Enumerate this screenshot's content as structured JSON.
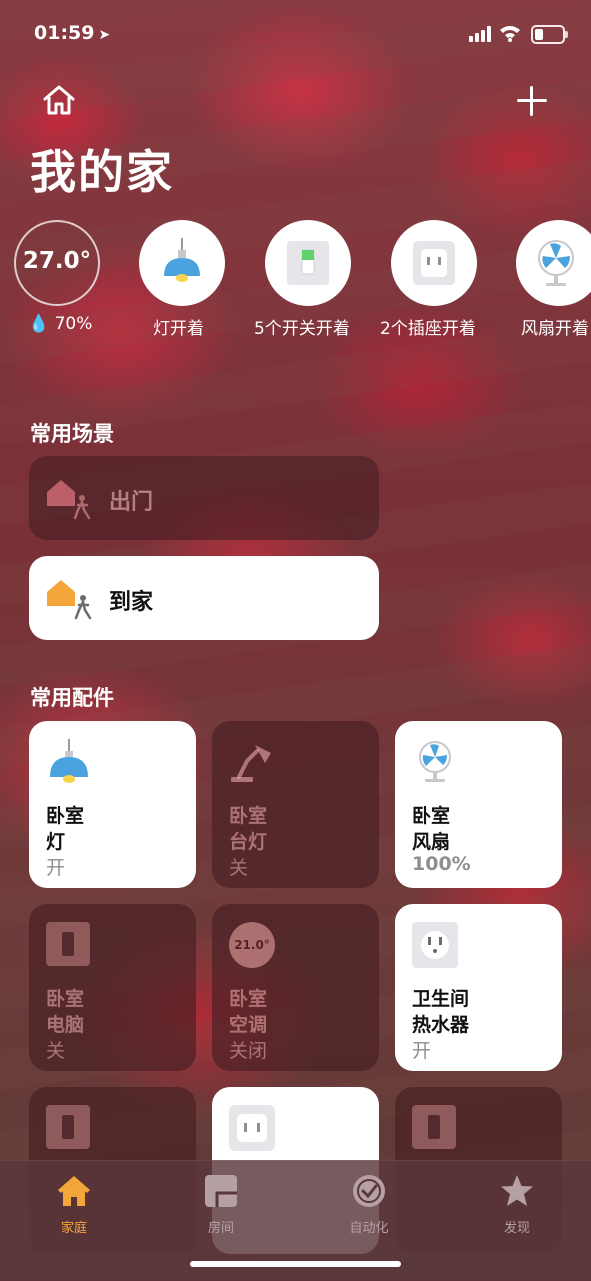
{
  "status_bar": {
    "time": "01:59",
    "location_glyph": "➤"
  },
  "header": {
    "title": "我的家"
  },
  "status_items": [
    {
      "label": "70%",
      "value": "27.0°",
      "icon": "humidity-drop-icon"
    },
    {
      "label": "灯开着",
      "icon": "pendant-lamp-icon"
    },
    {
      "label": "5个开关开着",
      "icon": "switch-icon"
    },
    {
      "label": "2个插座开着",
      "icon": "outlet-icon"
    },
    {
      "label": "风扇开着",
      "icon": "fan-icon"
    }
  ],
  "sections": {
    "scenes": "常用场景",
    "accessories": "常用配件"
  },
  "scenes": [
    {
      "label": "出门",
      "state": "off"
    },
    {
      "label": "到家",
      "state": "on"
    }
  ],
  "accessories": [
    {
      "room": "卧室",
      "name": "灯",
      "state": "开",
      "on": true,
      "icon": "pendant-lamp-icon"
    },
    {
      "room": "卧室",
      "name": "台灯",
      "state": "关",
      "on": false,
      "icon": "desk-lamp-icon"
    },
    {
      "room": "卧室",
      "name": "风扇",
      "state": "100%",
      "on": true,
      "icon": "fan-icon"
    },
    {
      "room": "卧室",
      "name": "电脑",
      "state": "关",
      "on": false,
      "icon": "switch-icon"
    },
    {
      "room": "卧室",
      "name": "空调",
      "state": "关闭",
      "on": false,
      "icon": "thermostat-icon",
      "setpoint": "21.0°"
    },
    {
      "room": "卫生间",
      "name": "热水器",
      "state": "开",
      "on": true,
      "icon": "outlet-icon"
    }
  ],
  "tabs": [
    {
      "label": "家庭",
      "icon": "home-icon",
      "active": true
    },
    {
      "label": "房间",
      "icon": "rooms-icon",
      "active": false
    },
    {
      "label": "自动化",
      "icon": "automation-icon",
      "active": false
    },
    {
      "label": "发现",
      "icon": "star-icon",
      "active": false
    }
  ],
  "colors": {
    "accent": "#f4a63a",
    "lamp_blue": "#4aa3df",
    "tile_on": "#ffffff"
  }
}
